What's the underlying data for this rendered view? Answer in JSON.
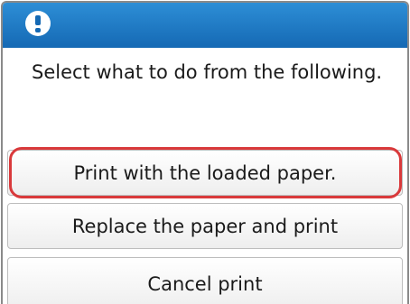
{
  "dialog": {
    "icon": "alert-icon",
    "message": "Select what to do from the following.",
    "options": [
      "Print with the loaded paper.",
      "Replace the paper and print",
      "Cancel print"
    ],
    "highlight_color": "#d9393b",
    "title_bar_color": "#1a78c8"
  }
}
